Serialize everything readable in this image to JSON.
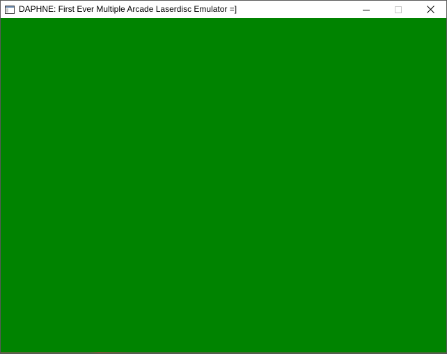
{
  "window": {
    "title": "DAPHNE: First Ever Multiple Arcade Laserdisc Emulator =]",
    "icon": "app-window-icon",
    "controls": {
      "minimize_icon": "minimize-icon",
      "maximize_icon": "maximize-icon",
      "close_icon": "close-icon"
    }
  },
  "client_area": {
    "color": "#008300"
  }
}
